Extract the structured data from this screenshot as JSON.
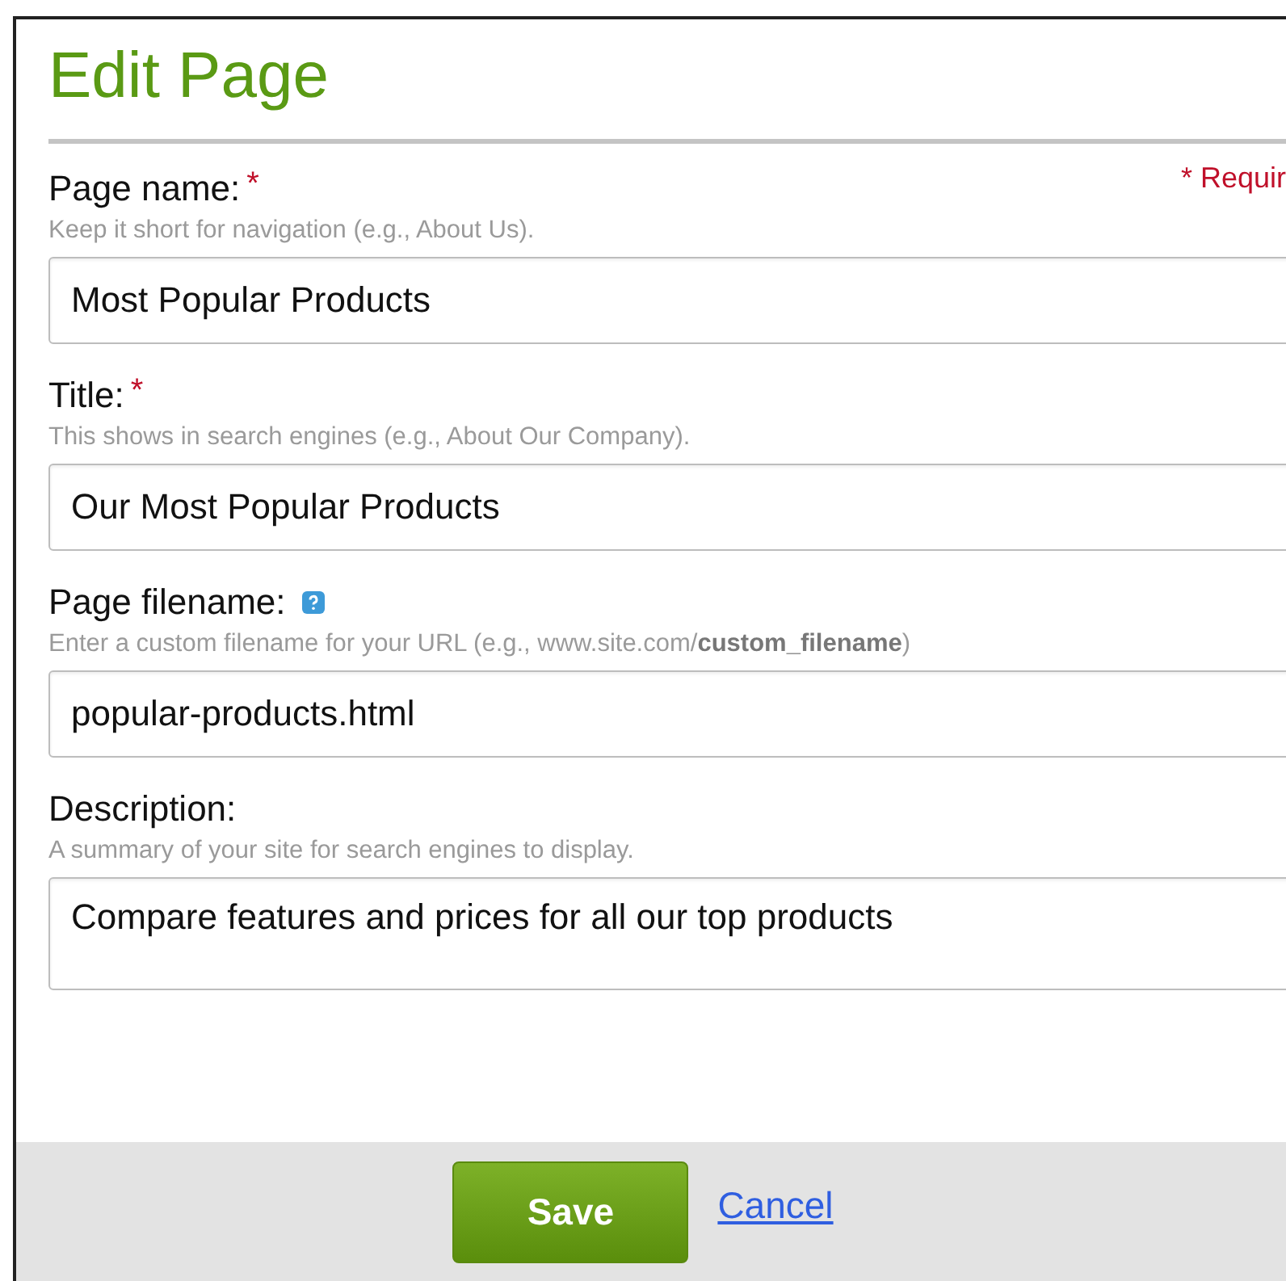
{
  "dialog": {
    "title": "Edit Page",
    "required_note": "* Requir"
  },
  "fields": [
    {
      "kind": "input",
      "label": "Page name:",
      "required_mark": "*",
      "hint": "Keep it short for navigation (e.g., About Us).",
      "value": "Most Popular Products"
    },
    {
      "kind": "input",
      "label": "Title:",
      "required_mark": "*",
      "hint": "This shows in search engines (e.g., About Our Company).",
      "value": "Our Most Popular Products"
    },
    {
      "kind": "input",
      "label": "Page filename:",
      "help": true,
      "hint": "Enter a custom filename for your URL (e.g., www.site.com/**custom_filename**)",
      "value": "popular-products.html"
    },
    {
      "kind": "textarea",
      "label": "Description:",
      "hint": "A summary of your site for search engines to display.",
      "value": "Compare features and prices for all our top products"
    }
  ],
  "buttons": {
    "save": "Save",
    "cancel": "Cancel"
  }
}
